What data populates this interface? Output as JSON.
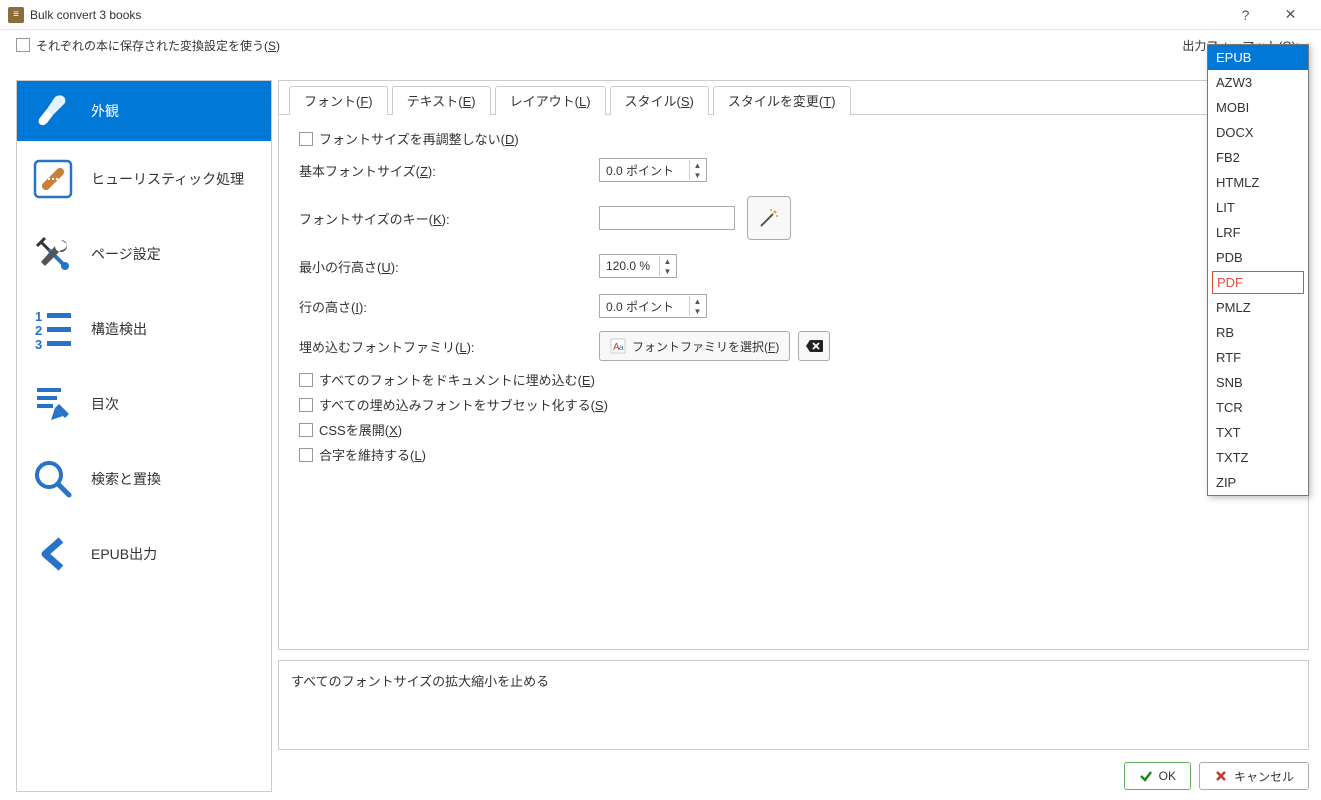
{
  "titlebar": {
    "title": "Bulk convert 3 books"
  },
  "topbar": {
    "use_saved_label_pre": "それぞれの本に保存された変換設定を使う(",
    "use_saved_label_key": "S",
    "use_saved_label_post": ")",
    "output_label_pre": "出力フォーマット(",
    "output_label_key": "O",
    "output_label_post": "):"
  },
  "sidebar": {
    "items": [
      {
        "label": "外観"
      },
      {
        "label": "ヒューリスティック処理"
      },
      {
        "label": "ページ設定"
      },
      {
        "label": "構造検出"
      },
      {
        "label": "目次"
      },
      {
        "label": "検索と置換"
      },
      {
        "label": "EPUB出力"
      }
    ]
  },
  "tabs": [
    {
      "pre": "フォント(",
      "key": "F",
      "post": ")"
    },
    {
      "pre": "テキスト(",
      "key": "E",
      "post": ")"
    },
    {
      "pre": "レイアウト(",
      "key": "L",
      "post": ")"
    },
    {
      "pre": "スタイル(",
      "key": "S",
      "post": ")"
    },
    {
      "pre": "スタイルを変更(",
      "key": "T",
      "post": ")"
    }
  ],
  "form": {
    "no_rescale_pre": "フォントサイズを再調整しない(",
    "no_rescale_key": "D",
    "no_rescale_post": ")",
    "base_size_pre": "基本フォントサイズ(",
    "base_size_key": "Z",
    "base_size_post": "):",
    "base_size_val": "0.0 ポイント",
    "size_key_pre": "フォントサイズのキー(",
    "size_key_key": "K",
    "size_key_post": "):",
    "min_line_pre": "最小の行高さ(",
    "min_line_key": "U",
    "min_line_post": "):",
    "min_line_val": "120.0 %",
    "line_h_pre": "行の高さ(",
    "line_h_key": "I",
    "line_h_post": "):",
    "line_h_val": "0.0 ポイント",
    "embed_family_pre": "埋め込むフォントファミリ(",
    "embed_family_key": "L",
    "embed_family_post": "):",
    "choose_family_pre": "フォントファミリを選択(",
    "choose_family_key": "F",
    "choose_family_post": ")",
    "embed_all_pre": "すべてのフォントをドキュメントに埋め込む(",
    "embed_all_key": "E",
    "embed_all_post": ")",
    "subset_pre": "すべての埋め込みフォントをサブセット化する(",
    "subset_key": "S",
    "subset_post": ")",
    "css_pre": "CSSを展開(",
    "css_key": "X",
    "css_post": ")",
    "liga_pre": "合字を維持する(",
    "liga_key": "L",
    "liga_post": ")"
  },
  "hint": "すべてのフォントサイズの拡大縮小を止める",
  "footer": {
    "ok": "OK",
    "cancel": "キャンセル"
  },
  "formats": [
    "EPUB",
    "AZW3",
    "MOBI",
    "DOCX",
    "FB2",
    "HTMLZ",
    "LIT",
    "LRF",
    "PDB",
    "PDF",
    "PMLZ",
    "RB",
    "RTF",
    "SNB",
    "TCR",
    "TXT",
    "TXTZ",
    "ZIP"
  ]
}
